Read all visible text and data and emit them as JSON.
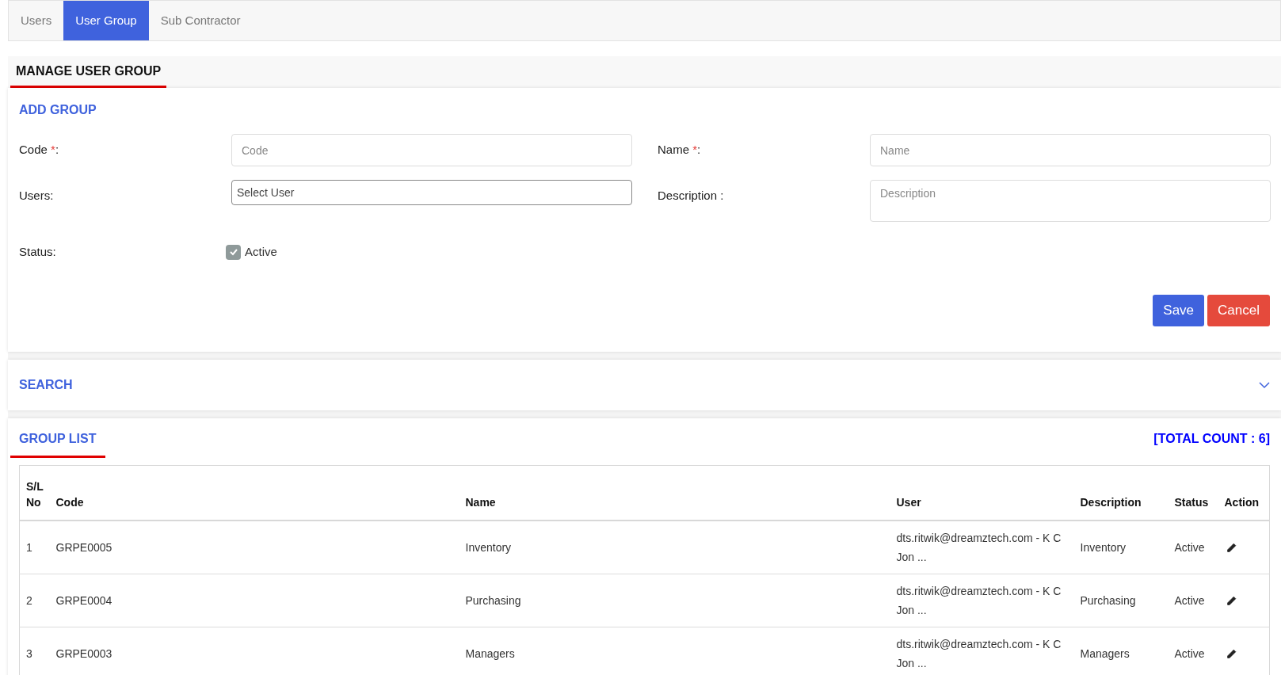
{
  "tabs": [
    {
      "label": "Users",
      "selected": false
    },
    {
      "label": "User Group",
      "selected": true
    },
    {
      "label": "Sub Contractor",
      "selected": false
    }
  ],
  "page_title": "MANAGE USER GROUP",
  "add_group": {
    "title": "ADD GROUP",
    "fields": [
      {
        "label": "Code",
        "required_mark": "*",
        "suffix": ":",
        "kind": "text",
        "placeholder": "Code"
      },
      {
        "label": "Name",
        "required_mark": "*",
        "suffix": ":",
        "kind": "text",
        "placeholder": "Name"
      },
      {
        "label": "Users:",
        "kind": "select",
        "placeholder": "Select User"
      },
      {
        "label": "Description :",
        "kind": "textarea",
        "placeholder": "Description"
      }
    ],
    "status": {
      "label": "Status:",
      "checkbox_label": "Active",
      "checked": true
    },
    "buttons": [
      {
        "label": "Save",
        "kind": "primary"
      },
      {
        "label": "Cancel",
        "kind": "danger"
      }
    ]
  },
  "search": {
    "title": "SEARCH",
    "expanded": false
  },
  "group_list": {
    "title": "GROUP LIST",
    "total_count": "[TOTAL COUNT : 6]",
    "columns": [
      "S/L No",
      "Code",
      "Name",
      "User",
      "Description",
      "Status",
      "Action"
    ],
    "rows": [
      {
        "sl": "1",
        "code": "GRPE0005",
        "name": "Inventory",
        "user": "dts.ritwik@dreamztech.com - K C Jon ...",
        "description": "Inventory",
        "status": "Active"
      },
      {
        "sl": "2",
        "code": "GRPE0004",
        "name": "Purchasing",
        "user": "dts.ritwik@dreamztech.com - K C Jon ...",
        "description": "Purchasing",
        "status": "Active"
      },
      {
        "sl": "3",
        "code": "GRPE0003",
        "name": "Managers",
        "user": "dts.ritwik@dreamztech.com - K C Jon ...",
        "description": "Managers",
        "status": "Active"
      }
    ]
  }
}
